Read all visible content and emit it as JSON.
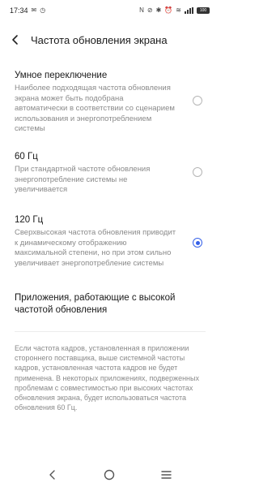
{
  "status_bar": {
    "time": "17:34",
    "battery": "100"
  },
  "header": {
    "title": "Частота обновления экрана"
  },
  "options": [
    {
      "title": "Умное переключение",
      "description": "Наиболее подходящая частота обновления экрана может быть подобрана автоматически в соответствии со сценарием использования и энергопотреблением системы",
      "selected": false
    },
    {
      "title": "60 Гц",
      "description": "При стандартной частоте обновления энергопотребление системы не увеличивается",
      "selected": false
    },
    {
      "title": "120 Гц",
      "description": "Сверхвысокая частота обновления приводит к динамическому отображению максимальной степени, но при этом сильно увеличивает энергопотребление системы",
      "selected": true
    }
  ],
  "apps_link": "Приложения, работающие с высокой частотой обновления",
  "footnote": "Если частота кадров, установленная в приложении стороннего поставщика, выше системной частоты кадров, установленная частота кадров не будет применена. В некоторых приложениях, подверженных проблемам с совместимостью при высоких частотах обновления экрана, будет использоваться частота обновления 60 Гц.",
  "colors": {
    "accent": "#3560e8",
    "secondary_text": "#8a8a8a"
  },
  "icons": {
    "back": "back-arrow-icon",
    "nav_back": "nav-back-icon",
    "nav_home": "nav-home-icon",
    "nav_menu": "nav-menu-icon"
  }
}
